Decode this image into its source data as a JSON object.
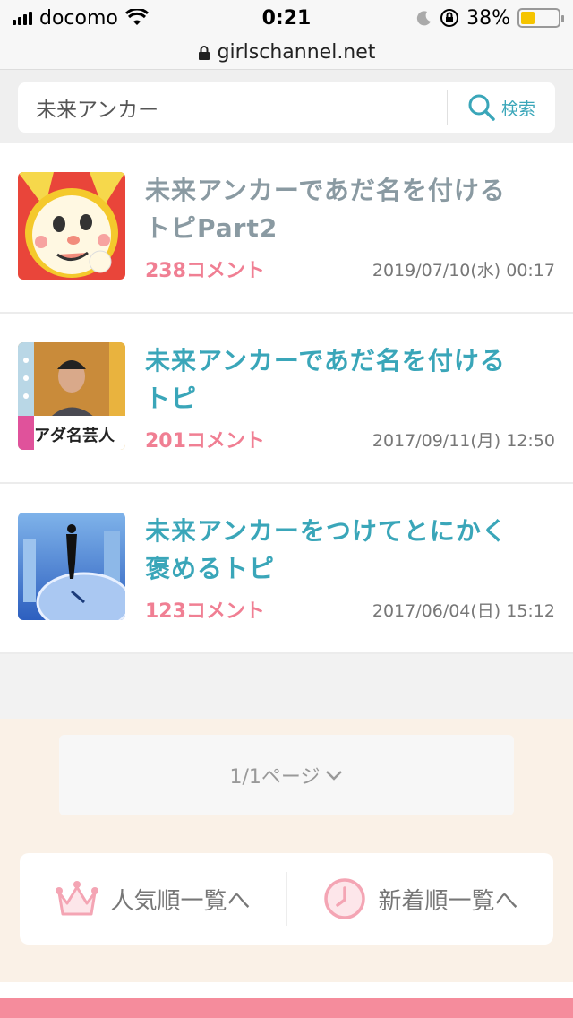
{
  "status_bar": {
    "carrier": "docomo",
    "time": "0:21",
    "battery_percent": "38%",
    "battery_level": 0.38
  },
  "url_bar": {
    "domain": "girlschannel.net"
  },
  "search": {
    "value": "未来アンカー",
    "button_label": "検索"
  },
  "topics": [
    {
      "title_line1": "未来アンカーであだ名を付ける",
      "title_line2": "トピPart2",
      "comments": "238コメント",
      "date": "2019/07/10(水) 00:17",
      "title_color": "#8a9aa2"
    },
    {
      "title_line1": "未来アンカーであだ名を付ける",
      "title_line2": "トピ",
      "comments": "201コメント",
      "date": "2017/09/11(月) 12:50",
      "title_color": "#3aa6b9",
      "thumb_caption": "アダ名芸人"
    },
    {
      "title_line1": "未来アンカーをつけてとにかく",
      "title_line2": "褒めるトピ",
      "comments": "123コメント",
      "date": "2017/06/04(日) 15:12",
      "title_color": "#3aa6b9"
    }
  ],
  "pager": {
    "label": "1/1ページ"
  },
  "sort": {
    "popular_label": "人気順一覧へ",
    "new_label": "新着順一覧へ"
  },
  "colors": {
    "accent_teal": "#3aa6b9",
    "comment_pink": "#f07f93",
    "footer_pink": "#f58c9c",
    "beige_bg": "#faf1e7"
  }
}
